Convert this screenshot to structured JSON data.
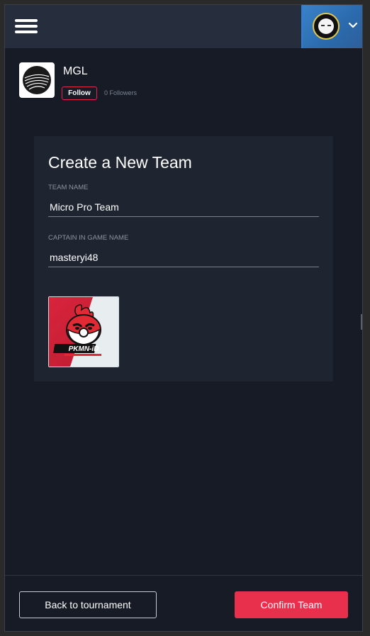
{
  "header": {
    "menu_icon": "hamburger-menu-icon",
    "user_avatar_icon": "user-avatar-icon",
    "dropdown_icon": "chevron-down-icon"
  },
  "organization": {
    "name": "MGL",
    "follow_label": "Follow",
    "followers_text": "0 Followers",
    "logo_icon": "mgl-logo"
  },
  "form": {
    "title": "Create a New Team",
    "team_name": {
      "label": "TEAM NAME",
      "value": "Micro Pro Team"
    },
    "captain_name": {
      "label": "CAPTAIN IN GAME NAME",
      "value": "masteryi48"
    },
    "team_logo": {
      "text": "PKMN-iD",
      "icon": "team-logo-image"
    }
  },
  "footer": {
    "back_label": "Back to tournament",
    "confirm_label": "Confirm Team"
  },
  "colors": {
    "background": "#161b26",
    "topbar": "#262d3d",
    "card": "#1f2530",
    "accent_red": "#e8304d",
    "user_menu_blue": "#3b82c8"
  }
}
